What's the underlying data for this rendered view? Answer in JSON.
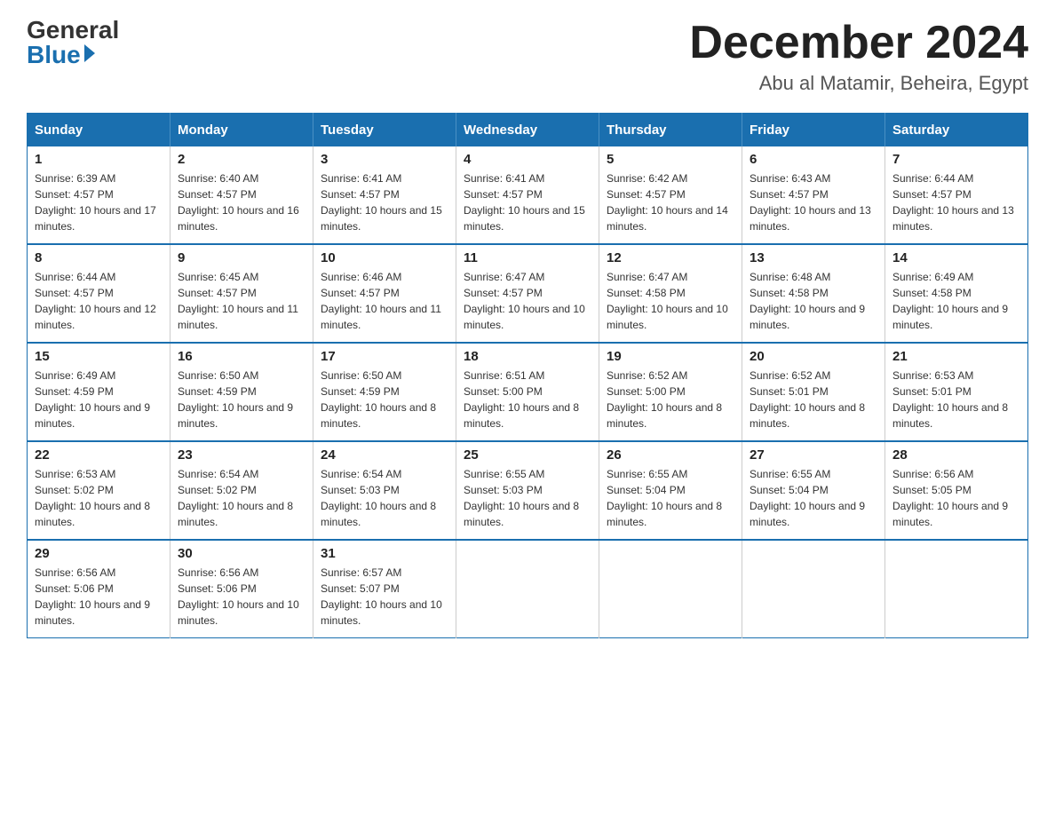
{
  "logo": {
    "general": "General",
    "blue": "Blue"
  },
  "title": {
    "month": "December 2024",
    "location": "Abu al Matamir, Beheira, Egypt"
  },
  "weekdays": [
    "Sunday",
    "Monday",
    "Tuesday",
    "Wednesday",
    "Thursday",
    "Friday",
    "Saturday"
  ],
  "weeks": [
    [
      {
        "day": "1",
        "sunrise": "6:39 AM",
        "sunset": "4:57 PM",
        "daylight": "10 hours and 17 minutes."
      },
      {
        "day": "2",
        "sunrise": "6:40 AM",
        "sunset": "4:57 PM",
        "daylight": "10 hours and 16 minutes."
      },
      {
        "day": "3",
        "sunrise": "6:41 AM",
        "sunset": "4:57 PM",
        "daylight": "10 hours and 15 minutes."
      },
      {
        "day": "4",
        "sunrise": "6:41 AM",
        "sunset": "4:57 PM",
        "daylight": "10 hours and 15 minutes."
      },
      {
        "day": "5",
        "sunrise": "6:42 AM",
        "sunset": "4:57 PM",
        "daylight": "10 hours and 14 minutes."
      },
      {
        "day": "6",
        "sunrise": "6:43 AM",
        "sunset": "4:57 PM",
        "daylight": "10 hours and 13 minutes."
      },
      {
        "day": "7",
        "sunrise": "6:44 AM",
        "sunset": "4:57 PM",
        "daylight": "10 hours and 13 minutes."
      }
    ],
    [
      {
        "day": "8",
        "sunrise": "6:44 AM",
        "sunset": "4:57 PM",
        "daylight": "10 hours and 12 minutes."
      },
      {
        "day": "9",
        "sunrise": "6:45 AM",
        "sunset": "4:57 PM",
        "daylight": "10 hours and 11 minutes."
      },
      {
        "day": "10",
        "sunrise": "6:46 AM",
        "sunset": "4:57 PM",
        "daylight": "10 hours and 11 minutes."
      },
      {
        "day": "11",
        "sunrise": "6:47 AM",
        "sunset": "4:57 PM",
        "daylight": "10 hours and 10 minutes."
      },
      {
        "day": "12",
        "sunrise": "6:47 AM",
        "sunset": "4:58 PM",
        "daylight": "10 hours and 10 minutes."
      },
      {
        "day": "13",
        "sunrise": "6:48 AM",
        "sunset": "4:58 PM",
        "daylight": "10 hours and 9 minutes."
      },
      {
        "day": "14",
        "sunrise": "6:49 AM",
        "sunset": "4:58 PM",
        "daylight": "10 hours and 9 minutes."
      }
    ],
    [
      {
        "day": "15",
        "sunrise": "6:49 AM",
        "sunset": "4:59 PM",
        "daylight": "10 hours and 9 minutes."
      },
      {
        "day": "16",
        "sunrise": "6:50 AM",
        "sunset": "4:59 PM",
        "daylight": "10 hours and 9 minutes."
      },
      {
        "day": "17",
        "sunrise": "6:50 AM",
        "sunset": "4:59 PM",
        "daylight": "10 hours and 8 minutes."
      },
      {
        "day": "18",
        "sunrise": "6:51 AM",
        "sunset": "5:00 PM",
        "daylight": "10 hours and 8 minutes."
      },
      {
        "day": "19",
        "sunrise": "6:52 AM",
        "sunset": "5:00 PM",
        "daylight": "10 hours and 8 minutes."
      },
      {
        "day": "20",
        "sunrise": "6:52 AM",
        "sunset": "5:01 PM",
        "daylight": "10 hours and 8 minutes."
      },
      {
        "day": "21",
        "sunrise": "6:53 AM",
        "sunset": "5:01 PM",
        "daylight": "10 hours and 8 minutes."
      }
    ],
    [
      {
        "day": "22",
        "sunrise": "6:53 AM",
        "sunset": "5:02 PM",
        "daylight": "10 hours and 8 minutes."
      },
      {
        "day": "23",
        "sunrise": "6:54 AM",
        "sunset": "5:02 PM",
        "daylight": "10 hours and 8 minutes."
      },
      {
        "day": "24",
        "sunrise": "6:54 AM",
        "sunset": "5:03 PM",
        "daylight": "10 hours and 8 minutes."
      },
      {
        "day": "25",
        "sunrise": "6:55 AM",
        "sunset": "5:03 PM",
        "daylight": "10 hours and 8 minutes."
      },
      {
        "day": "26",
        "sunrise": "6:55 AM",
        "sunset": "5:04 PM",
        "daylight": "10 hours and 8 minutes."
      },
      {
        "day": "27",
        "sunrise": "6:55 AM",
        "sunset": "5:04 PM",
        "daylight": "10 hours and 9 minutes."
      },
      {
        "day": "28",
        "sunrise": "6:56 AM",
        "sunset": "5:05 PM",
        "daylight": "10 hours and 9 minutes."
      }
    ],
    [
      {
        "day": "29",
        "sunrise": "6:56 AM",
        "sunset": "5:06 PM",
        "daylight": "10 hours and 9 minutes."
      },
      {
        "day": "30",
        "sunrise": "6:56 AM",
        "sunset": "5:06 PM",
        "daylight": "10 hours and 10 minutes."
      },
      {
        "day": "31",
        "sunrise": "6:57 AM",
        "sunset": "5:07 PM",
        "daylight": "10 hours and 10 minutes."
      },
      null,
      null,
      null,
      null
    ]
  ],
  "labels": {
    "sunrise": "Sunrise: ",
    "sunset": "Sunset: ",
    "daylight": "Daylight: "
  }
}
